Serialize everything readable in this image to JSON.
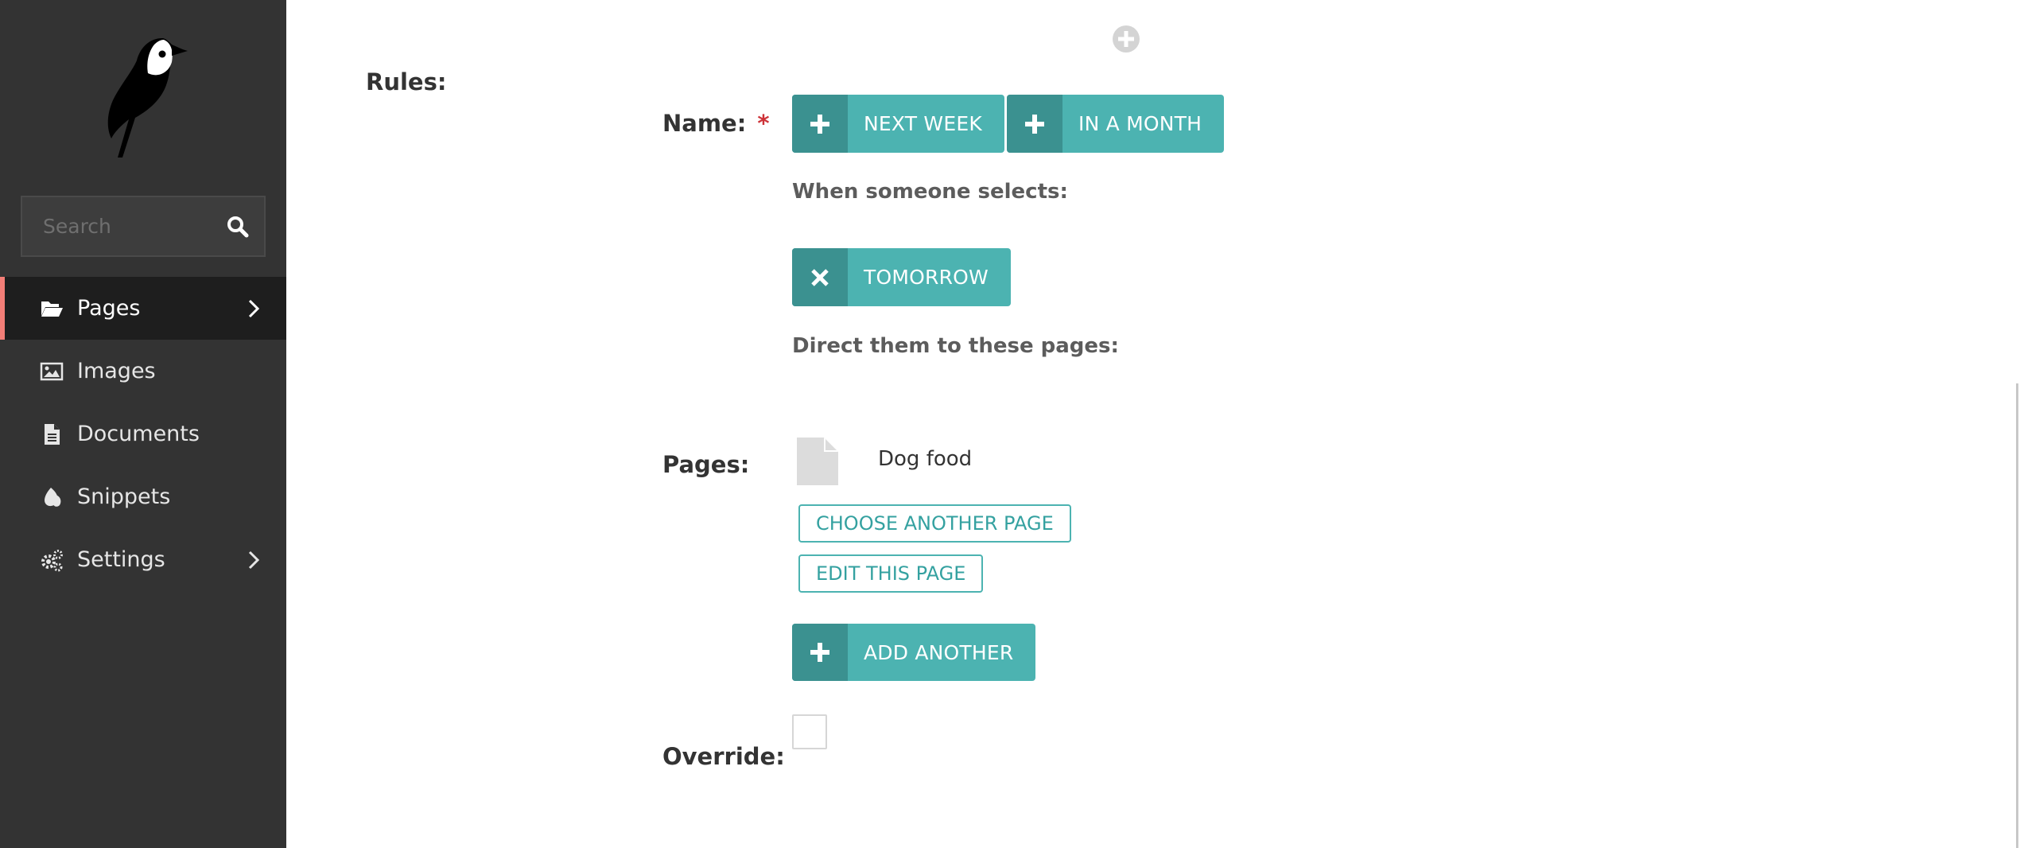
{
  "sidebar": {
    "search": {
      "placeholder": "Search",
      "icon": "search-icon"
    },
    "items": [
      {
        "label": "Pages",
        "icon": "folder-open-icon",
        "active": true,
        "has_children": true
      },
      {
        "label": "Images",
        "icon": "image-icon",
        "active": false,
        "has_children": false
      },
      {
        "label": "Documents",
        "icon": "document-icon",
        "active": false,
        "has_children": false
      },
      {
        "label": "Snippets",
        "icon": "snippet-icon",
        "active": false,
        "has_children": false
      },
      {
        "label": "Settings",
        "icon": "cogs-icon",
        "active": false,
        "has_children": true
      }
    ]
  },
  "form": {
    "rules_label": "Rules:",
    "name_label": "Name:",
    "required_marker": "*",
    "name_tags": [
      {
        "label": "NEXT WEEK",
        "icon": "plus-icon"
      },
      {
        "label": "IN A MONTH",
        "icon": "plus-icon"
      }
    ],
    "when_selects_label": "When someone selects:",
    "selected_tag": {
      "label": "TOMORROW",
      "icon": "close-icon"
    },
    "direct_label": "Direct them to these pages:",
    "pages_label": "Pages:",
    "selected_page": "Dog food",
    "choose_another_page": "CHOOSE ANOTHER PAGE",
    "edit_this_page": "EDIT THIS PAGE",
    "add_another": "ADD ANOTHER",
    "override_label": "Override:",
    "override_checked": false
  },
  "colors": {
    "sidebar_bg": "#333333",
    "sidebar_active_bg": "#1e1e1e",
    "active_accent": "#f37e77",
    "teal": "#4cb3b1",
    "teal_dark": "#3b9190",
    "required": "#cd3238"
  }
}
